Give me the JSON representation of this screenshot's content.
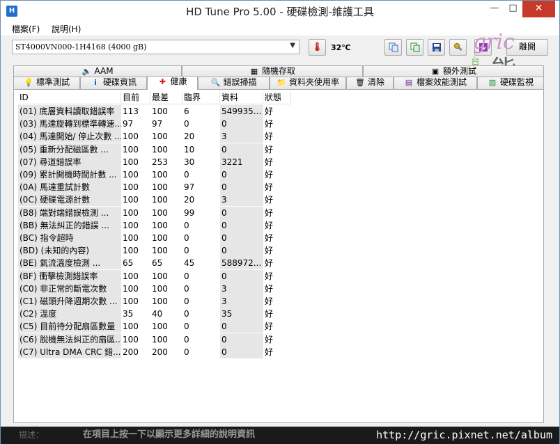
{
  "window": {
    "title": "HD Tune Pro  5.00 - 硬碟檢測-維護工具",
    "minimize": "—",
    "maximize": "□",
    "close": "✕"
  },
  "menu": {
    "file": "檔案(F)",
    "help": "說明(H)"
  },
  "toolbar": {
    "drive": "ST4000VN000-1H4168 (4000 gB)",
    "temperature": "32℃",
    "exit_label": "離開",
    "buttons": [
      "copy-icon",
      "copy-all-icon",
      "save-icon",
      "options-icon",
      "download-icon"
    ]
  },
  "watermark": {
    "gric": "gric",
    "neng": "能",
    "tai": "台灣"
  },
  "tabs_row1": [
    {
      "label": "AAM",
      "icon": "speaker-icon"
    },
    {
      "label": "隨機存取",
      "icon": "random-access-icon"
    },
    {
      "label": "額外測試",
      "icon": "extra-tests-icon"
    }
  ],
  "tabs_row2": [
    {
      "label": "標準測試",
      "icon": "benchmark-icon"
    },
    {
      "label": "硬碟資訊",
      "icon": "info-icon"
    },
    {
      "label": "健康",
      "icon": "health-cross-icon",
      "active": true
    },
    {
      "label": "錯誤掃描",
      "icon": "magnifier-icon"
    },
    {
      "label": "資料夾使用率",
      "icon": "folder-icon"
    },
    {
      "label": "清除",
      "icon": "trash-icon"
    },
    {
      "label": "檔案效能測試",
      "icon": "file-benchmark-icon"
    },
    {
      "label": "硬碟監視",
      "icon": "monitor-icon"
    }
  ],
  "table": {
    "headers": [
      "ID",
      "目前",
      "最差",
      "臨界",
      "資料",
      "狀態"
    ],
    "rows": [
      {
        "id": "(01) 底層資料讀取錯誤率",
        "cur": "113",
        "worst": "100",
        "thr": "6",
        "data": "549935...",
        "status": "好"
      },
      {
        "id": "(03) 馬達旋轉到標準轉速...",
        "cur": "97",
        "worst": "97",
        "thr": "0",
        "data": "0",
        "status": "好"
      },
      {
        "id": "(04) 馬達開始/ 停止次數 ...",
        "cur": "100",
        "worst": "100",
        "thr": "20",
        "data": "3",
        "status": "好"
      },
      {
        "id": "(05) 重新分配磁區數 ...",
        "cur": "100",
        "worst": "100",
        "thr": "10",
        "data": "0",
        "status": "好"
      },
      {
        "id": "(07) 尋道錯誤率",
        "cur": "100",
        "worst": "253",
        "thr": "30",
        "data": "3221",
        "status": "好"
      },
      {
        "id": "(09) 累計開機時間計數 ...",
        "cur": "100",
        "worst": "100",
        "thr": "0",
        "data": "0",
        "status": "好"
      },
      {
        "id": "(0A) 馬達重試計數",
        "cur": "100",
        "worst": "100",
        "thr": "97",
        "data": "0",
        "status": "好"
      },
      {
        "id": "(0C) 硬碟電源計數",
        "cur": "100",
        "worst": "100",
        "thr": "20",
        "data": "3",
        "status": "好"
      },
      {
        "id": "(B8) 端對端錯誤檢測 ...",
        "cur": "100",
        "worst": "100",
        "thr": "99",
        "data": "0",
        "status": "好"
      },
      {
        "id": "(BB) 無法糾正的錯誤 ...",
        "cur": "100",
        "worst": "100",
        "thr": "0",
        "data": "0",
        "status": "好"
      },
      {
        "id": "(BC) 指令超時",
        "cur": "100",
        "worst": "100",
        "thr": "0",
        "data": "0",
        "status": "好"
      },
      {
        "id": "(BD) (未知的內容)",
        "cur": "100",
        "worst": "100",
        "thr": "0",
        "data": "0",
        "status": "好"
      },
      {
        "id": "(BE) 氣流溫度檢測 ...",
        "cur": "65",
        "worst": "65",
        "thr": "45",
        "data": "588972...",
        "status": "好"
      },
      {
        "id": "(BF) 衝擊檢測錯誤率",
        "cur": "100",
        "worst": "100",
        "thr": "0",
        "data": "0",
        "status": "好"
      },
      {
        "id": "(C0) 非正常的斷電次數",
        "cur": "100",
        "worst": "100",
        "thr": "0",
        "data": "3",
        "status": "好"
      },
      {
        "id": "(C1) 磁頭升降週期次數 ...",
        "cur": "100",
        "worst": "100",
        "thr": "0",
        "data": "3",
        "status": "好"
      },
      {
        "id": "(C2) 溫度",
        "cur": "35",
        "worst": "40",
        "thr": "0",
        "data": "35",
        "status": "好"
      },
      {
        "id": "(C5) 目前待分配扇區數量",
        "cur": "100",
        "worst": "100",
        "thr": "0",
        "data": "0",
        "status": "好"
      },
      {
        "id": "(C6) 脫機無法糾正的扇區...",
        "cur": "100",
        "worst": "100",
        "thr": "0",
        "data": "0",
        "status": "好"
      },
      {
        "id": "(C7) Ultra DMA CRC 錯...",
        "cur": "200",
        "worst": "200",
        "thr": "0",
        "data": "0",
        "status": "好"
      }
    ]
  },
  "status_bar": {
    "label": "描述：",
    "description": "在項目上按一下以顯示更多詳細的說明資訊",
    "url": "http://gric.pixnet.net/album"
  }
}
